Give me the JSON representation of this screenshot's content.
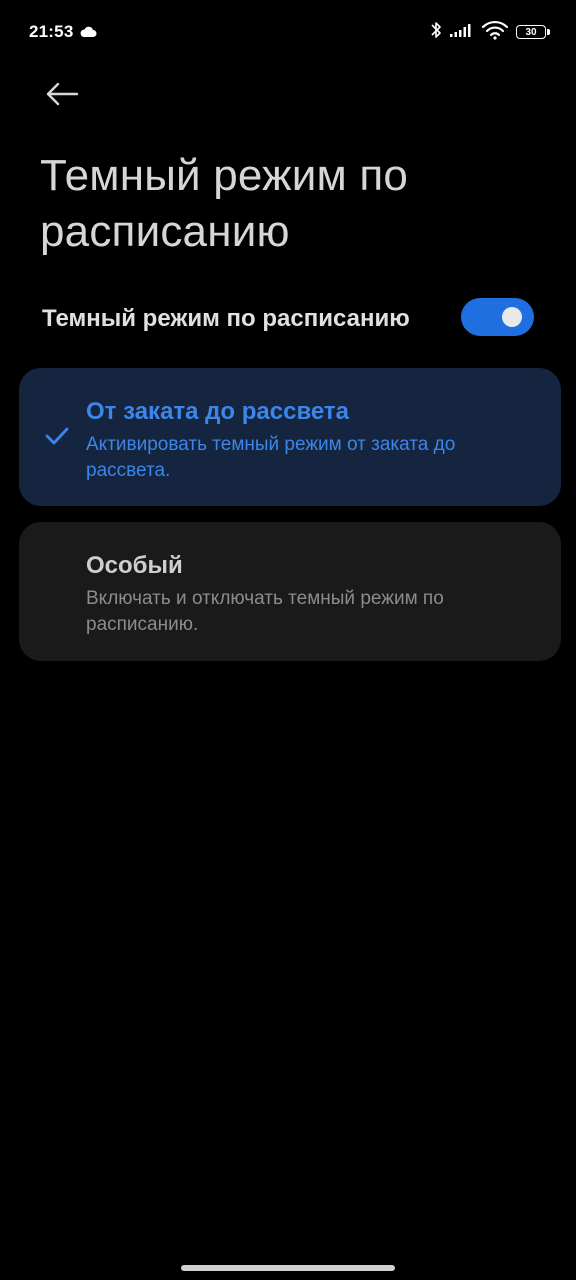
{
  "status_bar": {
    "time": "21:53",
    "battery": "30",
    "icons": [
      "cloud-icon",
      "bluetooth-icon",
      "signal-icon",
      "wifi-icon",
      "battery-icon"
    ]
  },
  "header": {
    "back_icon": "arrow-left-icon",
    "title": "Темный режим по расписанию"
  },
  "toggle": {
    "label": "Темный режим по расписанию",
    "state": "on",
    "accent_color": "#1f6fe0"
  },
  "options": [
    {
      "title": "От заката до рассвета",
      "description": "Активировать темный режим от заката до рассвета.",
      "selected": true
    },
    {
      "title": "Особый",
      "description": "Включать и отключать темный режим по расписанию.",
      "selected": false
    }
  ],
  "colors": {
    "background": "#000000",
    "selected_card": "#152540",
    "card": "#1a1a1a",
    "accent": "#3b86e8"
  }
}
